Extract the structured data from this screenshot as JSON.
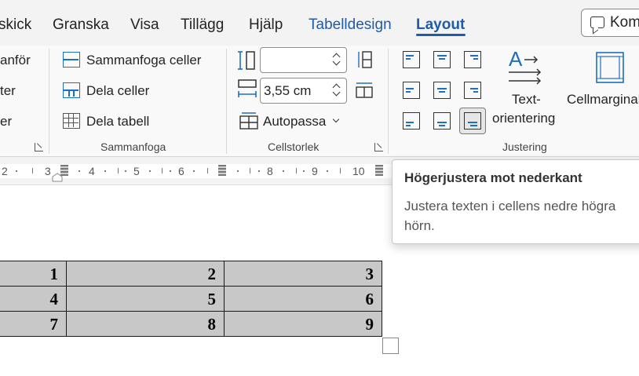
{
  "tabs": {
    "items": [
      "skick",
      "Granska",
      "Visa",
      "Tillägg",
      "Hjälp",
      "Tabelldesign",
      "Layout"
    ],
    "comments_label": "Kom"
  },
  "ribbon": {
    "insert_group": {
      "items": [
        "anför",
        "ter",
        "er"
      ]
    },
    "merge_group": {
      "merge_cells": "Sammanfoga celler",
      "split_cells": "Dela celler",
      "split_table": "Dela tabell",
      "label": "Sammanfoga"
    },
    "cell_size_group": {
      "height_value": "",
      "width_value": "3,55 cm",
      "autofit": "Autopassa",
      "label": "Cellstorlek"
    },
    "alignment_group": {
      "text_direction_line1": "Text-",
      "text_direction_line2": "orientering",
      "cell_margins": "Cellmarginal",
      "label": "Justering",
      "selected": "bottom-right"
    }
  },
  "ruler": {
    "numbers": [
      "2",
      "3",
      "4",
      "5",
      "6",
      "8",
      "9",
      "10"
    ]
  },
  "tooltip": {
    "title": "Högerjustera mot nederkant",
    "body": "Justera texten i cellens nedre högra hörn."
  },
  "table": {
    "rows": [
      [
        "1",
        "2",
        "3"
      ],
      [
        "4",
        "5",
        "6"
      ],
      [
        "7",
        "8",
        "9"
      ]
    ]
  },
  "colors": {
    "accent": "#1f5ba8",
    "icon_blue": "#1e6fc0",
    "cell_fill": "#c8c8c8"
  }
}
